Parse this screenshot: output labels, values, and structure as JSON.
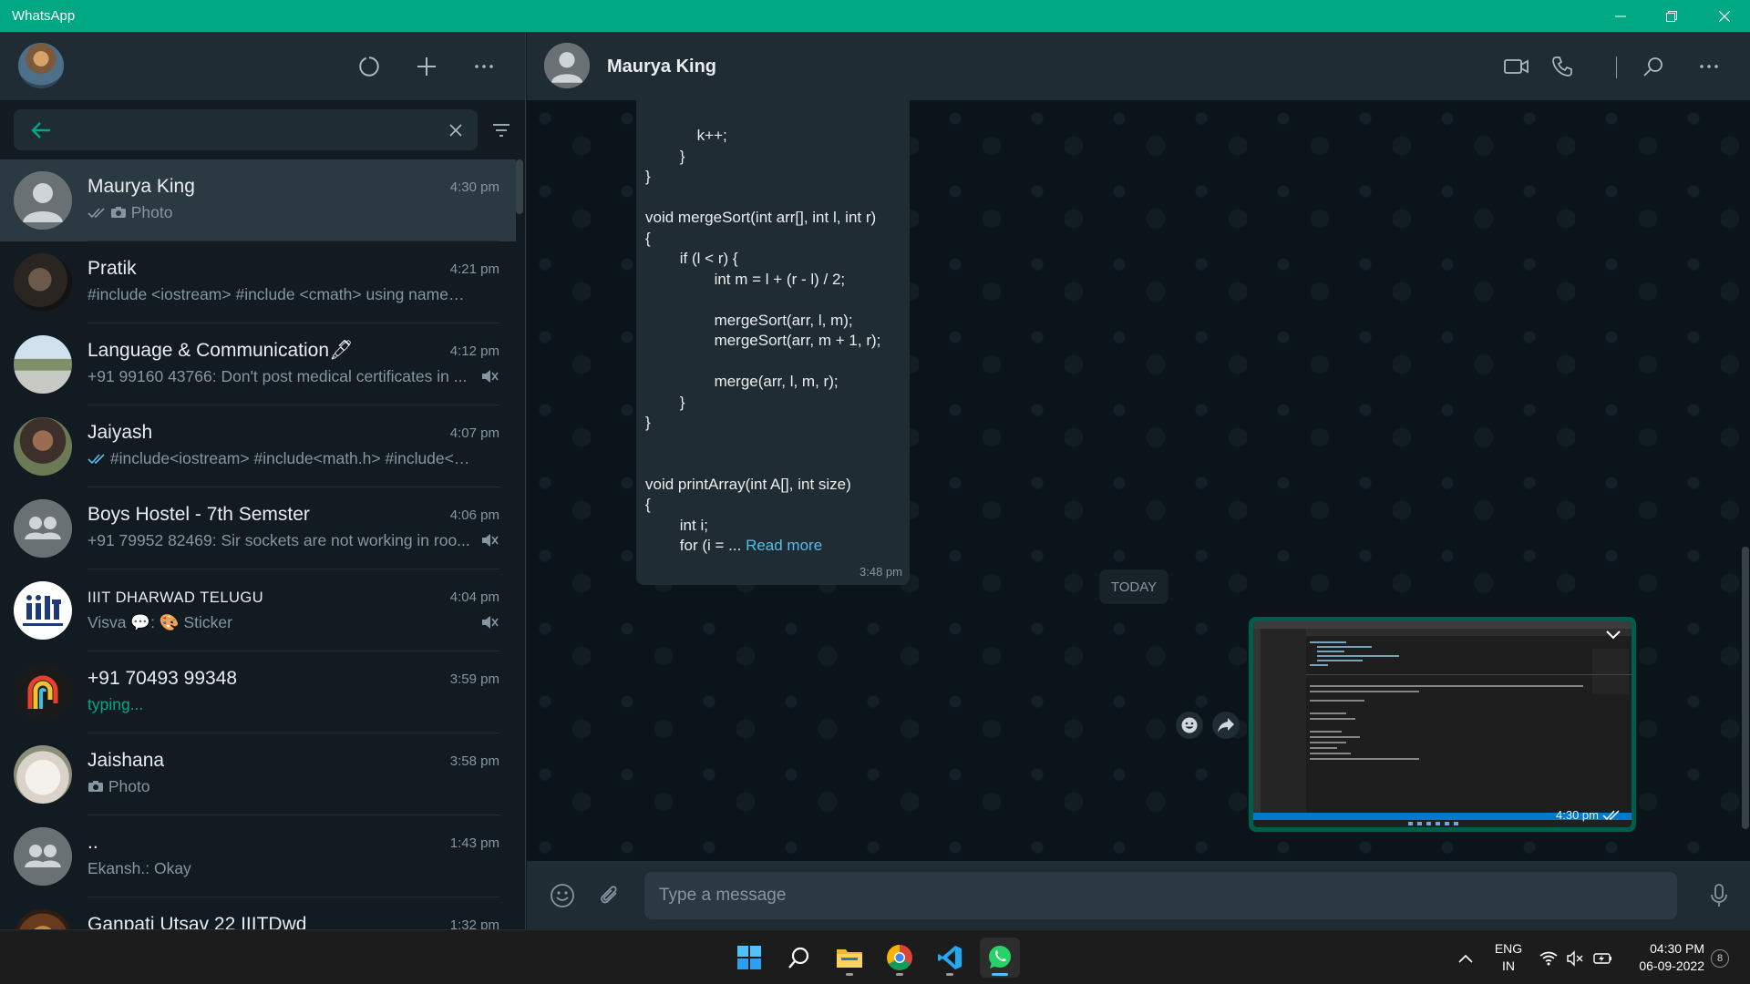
{
  "window": {
    "title": "WhatsApp"
  },
  "colors": {
    "accent": "#00a884",
    "panel": "#202c33",
    "bg": "#111b21",
    "bubble_out": "#005c4b",
    "link": "#53bdeb"
  },
  "sidebar": {
    "search": {
      "value": "",
      "placeholder": ""
    },
    "chats": [
      {
        "name": "Maurya King",
        "time": "4:30 pm",
        "preview": "Photo",
        "ticks": "read",
        "media": "camera-icon",
        "active": true
      },
      {
        "name": "Pratik",
        "time": "4:21 pm",
        "preview": "#include <iostream> #include <cmath> using namespa..."
      },
      {
        "name": "Language & Communication🖋",
        "time": "4:12 pm",
        "preview": "+91 99160 43766: Don't post medical certificates in ...",
        "muted": true
      },
      {
        "name": "Jaiyash",
        "time": "4:07 pm",
        "preview": "#include<iostream> #include<math.h> #include<st...",
        "ticks": "read-blue"
      },
      {
        "name": "Boys Hostel - 7th Semster",
        "time": "4:06 pm",
        "preview": "+91 79952 82469: Sir sockets are not working in roo...",
        "muted": true
      },
      {
        "name": "IIIT DHARWAD TELUGU",
        "time": "4:04 pm",
        "preview": "Visva 💬: 🎨 Sticker",
        "muted": true
      },
      {
        "name": "+91 70493 99348",
        "time": "3:59 pm",
        "preview": "typing...",
        "typing": true
      },
      {
        "name": "Jaishana",
        "time": "3:58 pm",
        "preview": "Photo",
        "media": "camera-icon"
      },
      {
        "name": "..",
        "time": "1:43 pm",
        "preview": "Ekansh.: Okay"
      },
      {
        "name": "Ganpati Utsav 22 IIITDwd",
        "time": "1:32 pm",
        "preview": ""
      }
    ]
  },
  "conversation": {
    "contact_name": "Maurya King",
    "incoming_message": {
      "code": "            k++;\n        }\n}\n\nvoid mergeSort(int arr[], int l, int r)\n{\n        if (l < r) {\n                int m = l + (r - l) / 2;\n\n                mergeSort(arr, l, m);\n                mergeSort(arr, m + 1, r);\n\n                merge(arr, l, m, r);\n        }\n}\n\n\nvoid printArray(int A[], int size)\n{\n        int i;\n        for (i = ... ",
      "read_more": "Read more",
      "time": "3:48 pm"
    },
    "date_divider": "TODAY",
    "outgoing_image": {
      "time": "4:30 pm",
      "ticks": "read"
    },
    "composer": {
      "placeholder": "Type a message",
      "value": ""
    }
  },
  "taskbar": {
    "apps": [
      "windows-start",
      "search",
      "file-explorer",
      "chrome",
      "vscode",
      "whatsapp"
    ],
    "language": "ENG",
    "region": "IN",
    "time": "04:30 PM",
    "date": "06-09-2022",
    "notification_count": "8"
  }
}
